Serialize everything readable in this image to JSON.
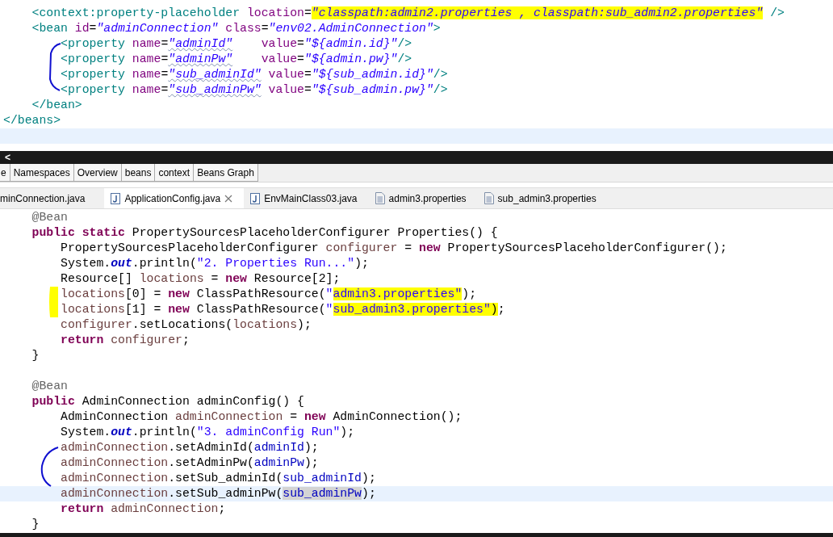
{
  "xml_editor": {
    "lines": [
      {
        "current": false,
        "tokens": [
          {
            "kind": "tag",
            "text": "    <context:property-placeholder "
          },
          {
            "kind": "attr",
            "text": "location"
          },
          {
            "kind": "plain",
            "text": "="
          },
          {
            "kind": "value-hl",
            "text": "\"classpath:admin2.properties , classpath:sub_admin2.properties\""
          },
          {
            "kind": "tag",
            "text": " />"
          }
        ]
      },
      {
        "current": false,
        "tokens": [
          {
            "kind": "tag",
            "text": "    <bean "
          },
          {
            "kind": "attr",
            "text": "id"
          },
          {
            "kind": "plain",
            "text": "="
          },
          {
            "kind": "value",
            "text": "\"adminConnection\""
          },
          {
            "kind": "attr",
            "text": " class"
          },
          {
            "kind": "plain",
            "text": "="
          },
          {
            "kind": "value",
            "text": "\"env02.AdminConnection\""
          },
          {
            "kind": "tag",
            "text": ">"
          }
        ]
      },
      {
        "current": false,
        "tokens": [
          {
            "kind": "tag",
            "text": "        <property "
          },
          {
            "kind": "attr",
            "text": "name"
          },
          {
            "kind": "plain",
            "text": "="
          },
          {
            "kind": "value-spell",
            "text": "\"adminId\""
          },
          {
            "kind": "attr",
            "text": "    value"
          },
          {
            "kind": "plain",
            "text": "="
          },
          {
            "kind": "value",
            "text": "\"${admin.id}\""
          },
          {
            "kind": "tag",
            "text": "/>"
          }
        ]
      },
      {
        "current": false,
        "tokens": [
          {
            "kind": "tag",
            "text": "        <property "
          },
          {
            "kind": "attr",
            "text": "name"
          },
          {
            "kind": "plain",
            "text": "="
          },
          {
            "kind": "value-spell",
            "text": "\"adminPw\""
          },
          {
            "kind": "attr",
            "text": "    value"
          },
          {
            "kind": "plain",
            "text": "="
          },
          {
            "kind": "value",
            "text": "\"${admin.pw}\""
          },
          {
            "kind": "tag",
            "text": "/>"
          }
        ]
      },
      {
        "current": false,
        "tokens": [
          {
            "kind": "tag",
            "text": "        <property "
          },
          {
            "kind": "attr",
            "text": "name"
          },
          {
            "kind": "plain",
            "text": "="
          },
          {
            "kind": "value-spell",
            "text": "\"sub_adminId\""
          },
          {
            "kind": "attr",
            "text": " value"
          },
          {
            "kind": "plain",
            "text": "="
          },
          {
            "kind": "value",
            "text": "\"${sub_admin.id}\""
          },
          {
            "kind": "tag",
            "text": "/>"
          }
        ]
      },
      {
        "current": false,
        "tokens": [
          {
            "kind": "tag",
            "text": "        <property "
          },
          {
            "kind": "attr",
            "text": "name"
          },
          {
            "kind": "plain",
            "text": "="
          },
          {
            "kind": "value-spell",
            "text": "\"sub_adminPw\""
          },
          {
            "kind": "attr",
            "text": " value"
          },
          {
            "kind": "plain",
            "text": "="
          },
          {
            "kind": "value",
            "text": "\"${sub_admin.pw}\""
          },
          {
            "kind": "tag",
            "text": "/>"
          }
        ]
      },
      {
        "current": false,
        "tokens": [
          {
            "kind": "tag",
            "text": "    </bean>"
          }
        ]
      },
      {
        "current": false,
        "tokens": [
          {
            "kind": "tag",
            "text": "</beans>"
          }
        ]
      },
      {
        "current": true
      }
    ]
  },
  "scroll_left": "<",
  "page_tabs": [
    {
      "label": "e"
    },
    {
      "label": "Namespaces"
    },
    {
      "label": "Overview"
    },
    {
      "label": "beans"
    },
    {
      "label": "context"
    },
    {
      "label": "Beans Graph"
    }
  ],
  "editor_tabs": [
    {
      "label": "minConnection.java",
      "kind": "cut",
      "selected": false
    },
    {
      "label": "ApplicationConfig.java",
      "kind": "java",
      "selected": true
    },
    {
      "label": "EnvMainClass03.java",
      "kind": "java",
      "selected": false
    },
    {
      "label": "admin3.properties",
      "kind": "properties",
      "selected": false
    },
    {
      "label": "sub_admin3.properties",
      "kind": "properties",
      "selected": false
    }
  ],
  "java_editor": {
    "lines": [
      {
        "current": false,
        "tokens": [
          {
            "kind": "ann",
            "text": "    @Bean"
          }
        ]
      },
      {
        "current": false,
        "tokens": [
          {
            "kind": "kw",
            "text": "    public"
          },
          {
            "kind": "kw",
            "text": " static"
          },
          {
            "kind": "plain",
            "text": " PropertySourcesPlaceholderConfigurer Properties() {"
          }
        ]
      },
      {
        "current": false,
        "tokens": [
          {
            "kind": "plain",
            "text": "        PropertySourcesPlaceholderConfigurer"
          },
          {
            "kind": "local",
            "text": " configurer"
          },
          {
            "kind": "plain",
            "text": " ="
          },
          {
            "kind": "kw",
            "text": " new"
          },
          {
            "kind": "plain",
            "text": " PropertySourcesPlaceholderConfigurer();"
          }
        ]
      },
      {
        "current": false,
        "tokens": [
          {
            "kind": "plain",
            "text": "        System."
          },
          {
            "kind": "static",
            "text": "out"
          },
          {
            "kind": "plain",
            "text": ".println("
          },
          {
            "kind": "str",
            "text": "\"2. Properties Run...\""
          },
          {
            "kind": "plain",
            "text": ");"
          }
        ]
      },
      {
        "current": false,
        "tokens": [
          {
            "kind": "plain",
            "text": "        Resource[]"
          },
          {
            "kind": "local",
            "text": " locations"
          },
          {
            "kind": "plain",
            "text": " ="
          },
          {
            "kind": "kw",
            "text": " new"
          },
          {
            "kind": "plain",
            "text": " Resource[2];"
          }
        ]
      },
      {
        "current": false,
        "tokens": [
          {
            "kind": "local",
            "text": "        locations"
          },
          {
            "kind": "plain",
            "text": "[0] ="
          },
          {
            "kind": "kw",
            "text": " new"
          },
          {
            "kind": "plain",
            "text": " ClassPathResource("
          },
          {
            "kind": "str",
            "text": "\""
          },
          {
            "kind": "str-hl",
            "text": "admin3.properties\""
          },
          {
            "kind": "plain",
            "text": ");"
          }
        ]
      },
      {
        "current": false,
        "tokens": [
          {
            "kind": "local",
            "text": "        locations"
          },
          {
            "kind": "plain",
            "text": "[1] ="
          },
          {
            "kind": "kw",
            "text": " new"
          },
          {
            "kind": "plain",
            "text": " ClassPathResource("
          },
          {
            "kind": "str",
            "text": "\""
          },
          {
            "kind": "str-hl",
            "text": "sub_admin3.properties\""
          },
          {
            "kind": "plain-hl",
            "text": ")"
          },
          {
            "kind": "plain",
            "text": ";"
          }
        ]
      },
      {
        "current": false,
        "tokens": [
          {
            "kind": "local",
            "text": "        configurer"
          },
          {
            "kind": "plain",
            "text": ".setLocations("
          },
          {
            "kind": "local",
            "text": "locations"
          },
          {
            "kind": "plain",
            "text": ");"
          }
        ]
      },
      {
        "current": false,
        "tokens": [
          {
            "kind": "kw",
            "text": "        return"
          },
          {
            "kind": "local",
            "text": " configurer"
          },
          {
            "kind": "plain",
            "text": ";"
          }
        ]
      },
      {
        "current": false,
        "tokens": [
          {
            "kind": "plain",
            "text": "    }"
          }
        ]
      },
      {
        "current": false
      },
      {
        "current": false,
        "tokens": [
          {
            "kind": "ann",
            "text": "    @Bean"
          }
        ]
      },
      {
        "current": false,
        "tokens": [
          {
            "kind": "kw",
            "text": "    public"
          },
          {
            "kind": "plain",
            "text": " AdminConnection adminConfig() {"
          }
        ]
      },
      {
        "current": false,
        "tokens": [
          {
            "kind": "plain",
            "text": "        AdminConnection"
          },
          {
            "kind": "local",
            "text": " adminConnection"
          },
          {
            "kind": "plain",
            "text": " ="
          },
          {
            "kind": "kw",
            "text": " new"
          },
          {
            "kind": "plain",
            "text": " AdminConnection();"
          }
        ]
      },
      {
        "current": false,
        "tokens": [
          {
            "kind": "plain",
            "text": "        System."
          },
          {
            "kind": "static",
            "text": "out"
          },
          {
            "kind": "plain",
            "text": ".println("
          },
          {
            "kind": "str",
            "text": "\"3. adminConfig Run\""
          },
          {
            "kind": "plain",
            "text": ");"
          }
        ]
      },
      {
        "current": false,
        "tokens": [
          {
            "kind": "local",
            "text": "        adminConnection"
          },
          {
            "kind": "plain",
            "text": ".setAdminId("
          },
          {
            "kind": "field",
            "text": "adminId"
          },
          {
            "kind": "plain",
            "text": ");"
          }
        ]
      },
      {
        "current": false,
        "tokens": [
          {
            "kind": "local",
            "text": "        adminConnection"
          },
          {
            "kind": "plain",
            "text": ".setAdminPw("
          },
          {
            "kind": "field",
            "text": "adminPw"
          },
          {
            "kind": "plain",
            "text": ");"
          }
        ]
      },
      {
        "current": false,
        "tokens": [
          {
            "kind": "local",
            "text": "        adminConnection"
          },
          {
            "kind": "plain",
            "text": ".setSub_adminId("
          },
          {
            "kind": "field",
            "text": "sub_adminId"
          },
          {
            "kind": "plain",
            "text": ");"
          }
        ]
      },
      {
        "current": true,
        "tokens": [
          {
            "kind": "local",
            "text": "        adminConnection"
          },
          {
            "kind": "plain",
            "text": ".setSub_adminPw("
          },
          {
            "kind": "field-occ",
            "text": "sub_adminPw"
          },
          {
            "kind": "plain",
            "text": ");"
          }
        ]
      },
      {
        "current": false,
        "tokens": [
          {
            "kind": "kw",
            "text": "        return"
          },
          {
            "kind": "local",
            "text": " adminConnection"
          },
          {
            "kind": "plain",
            "text": ";"
          }
        ]
      },
      {
        "current": false,
        "tokens": [
          {
            "kind": "plain",
            "text": "    }"
          }
        ]
      }
    ]
  }
}
